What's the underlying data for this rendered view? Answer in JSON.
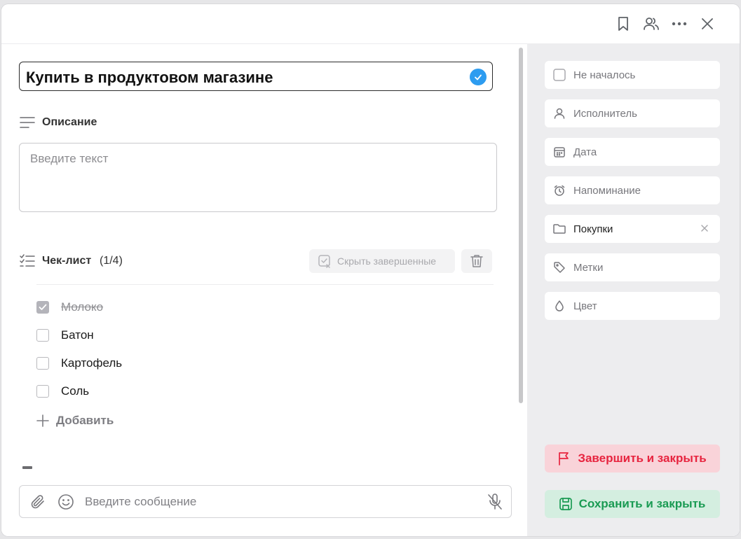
{
  "task": {
    "title": "Купить в продуктовом магазине"
  },
  "description": {
    "label": "Описание",
    "placeholder": "Введите текст"
  },
  "checklist": {
    "label": "Чек-лист",
    "progress": "(1/4)",
    "hide_completed_label": "Скрыть завершенные",
    "add_label": "Добавить",
    "items": [
      {
        "label": "Молоко",
        "done": true
      },
      {
        "label": "Батон",
        "done": false
      },
      {
        "label": "Картофель",
        "done": false
      },
      {
        "label": "Соль",
        "done": false
      }
    ]
  },
  "message": {
    "placeholder": "Введите сообщение"
  },
  "sidebar": {
    "status": "Не началось",
    "assignee": "Исполнитель",
    "date": "Дата",
    "reminder": "Напоминание",
    "folder": "Покупки",
    "tags": "Метки",
    "color": "Цвет"
  },
  "actions": {
    "finish_label": "Завершить и закрыть",
    "save_label": "Сохранить и закрыть"
  },
  "colors": {
    "accent_blue": "#2d9cf0",
    "finish_red": "#e7243f",
    "save_green": "#1a9b53"
  }
}
